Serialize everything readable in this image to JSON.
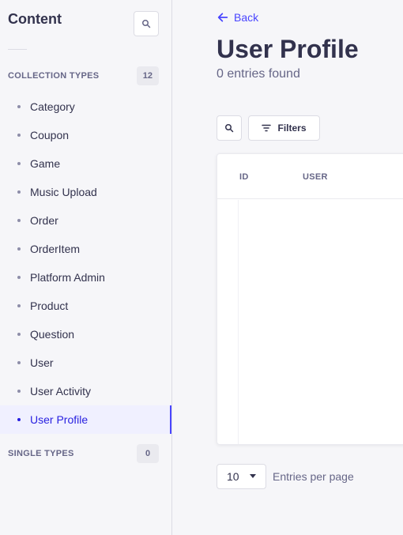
{
  "sidebar": {
    "title": "Content",
    "collection_types": {
      "label": "COLLECTION TYPES",
      "count": "12",
      "items": [
        {
          "label": "Category"
        },
        {
          "label": "Coupon"
        },
        {
          "label": "Game"
        },
        {
          "label": "Music Upload"
        },
        {
          "label": "Order"
        },
        {
          "label": "OrderItem"
        },
        {
          "label": "Platform Admin"
        },
        {
          "label": "Product"
        },
        {
          "label": "Question"
        },
        {
          "label": "User"
        },
        {
          "label": "User Activity"
        },
        {
          "label": "User Profile",
          "active": true
        }
      ]
    },
    "single_types": {
      "label": "SINGLE TYPES",
      "count": "0"
    }
  },
  "main": {
    "back_label": "Back",
    "title": "User Profile",
    "subtitle": "0 entries found",
    "filters_label": "Filters",
    "table": {
      "columns": [
        "ID",
        "USER"
      ]
    },
    "pagination": {
      "per_page_value": "10",
      "per_page_label": "Entries per page"
    }
  },
  "icons": {
    "sidebar_search": "search-icon",
    "back": "arrow-left-icon",
    "search": "search-icon",
    "filter": "filter-icon",
    "chevron": "chevron-down-icon"
  },
  "colors": {
    "accent": "#4945ff",
    "active_text": "#271fe0",
    "active_bg": "#f0f0ff"
  }
}
